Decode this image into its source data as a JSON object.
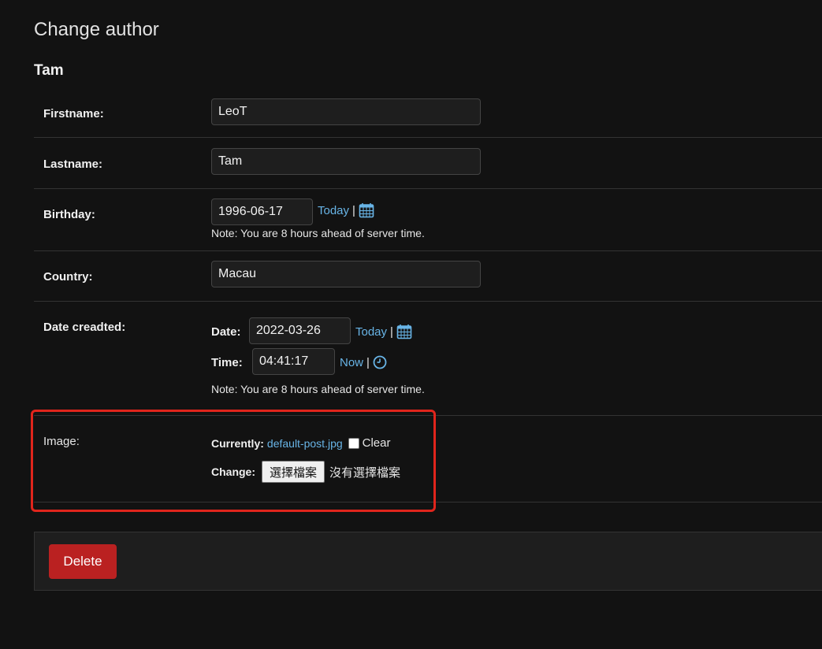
{
  "page": {
    "title": "Change author",
    "object_name": "Tam"
  },
  "fields": {
    "firstname": {
      "label": "Firstname:",
      "value": "LeoT"
    },
    "lastname": {
      "label": "Lastname:",
      "value": "Tam"
    },
    "birthday": {
      "label": "Birthday:",
      "value": "1996-06-17",
      "today_link": "Today",
      "separator": "|",
      "note": "Note: You are 8 hours ahead of server time."
    },
    "country": {
      "label": "Country:",
      "value": "Macau"
    },
    "date_created": {
      "label": "Date creadted:",
      "date_label": "Date:",
      "date_value": "2022-03-26",
      "today_link": "Today",
      "time_label": "Time:",
      "time_value": "04:41:17",
      "now_link": "Now",
      "separator": "|",
      "note": "Note: You are 8 hours ahead of server time."
    },
    "image": {
      "label": "Image:",
      "currently_label": "Currently:",
      "current_file": "default-post.jpg",
      "clear_label": "Clear",
      "change_label": "Change:",
      "file_button": "選擇檔案",
      "no_file_text": "沒有選擇檔案"
    }
  },
  "actions": {
    "delete_label": "Delete"
  },
  "icons": {
    "calendar": "calendar-icon",
    "clock": "clock-icon"
  },
  "colors": {
    "background": "#121212",
    "link": "#68b4e6",
    "delete": "#ba2121",
    "highlight": "#e0251c"
  }
}
